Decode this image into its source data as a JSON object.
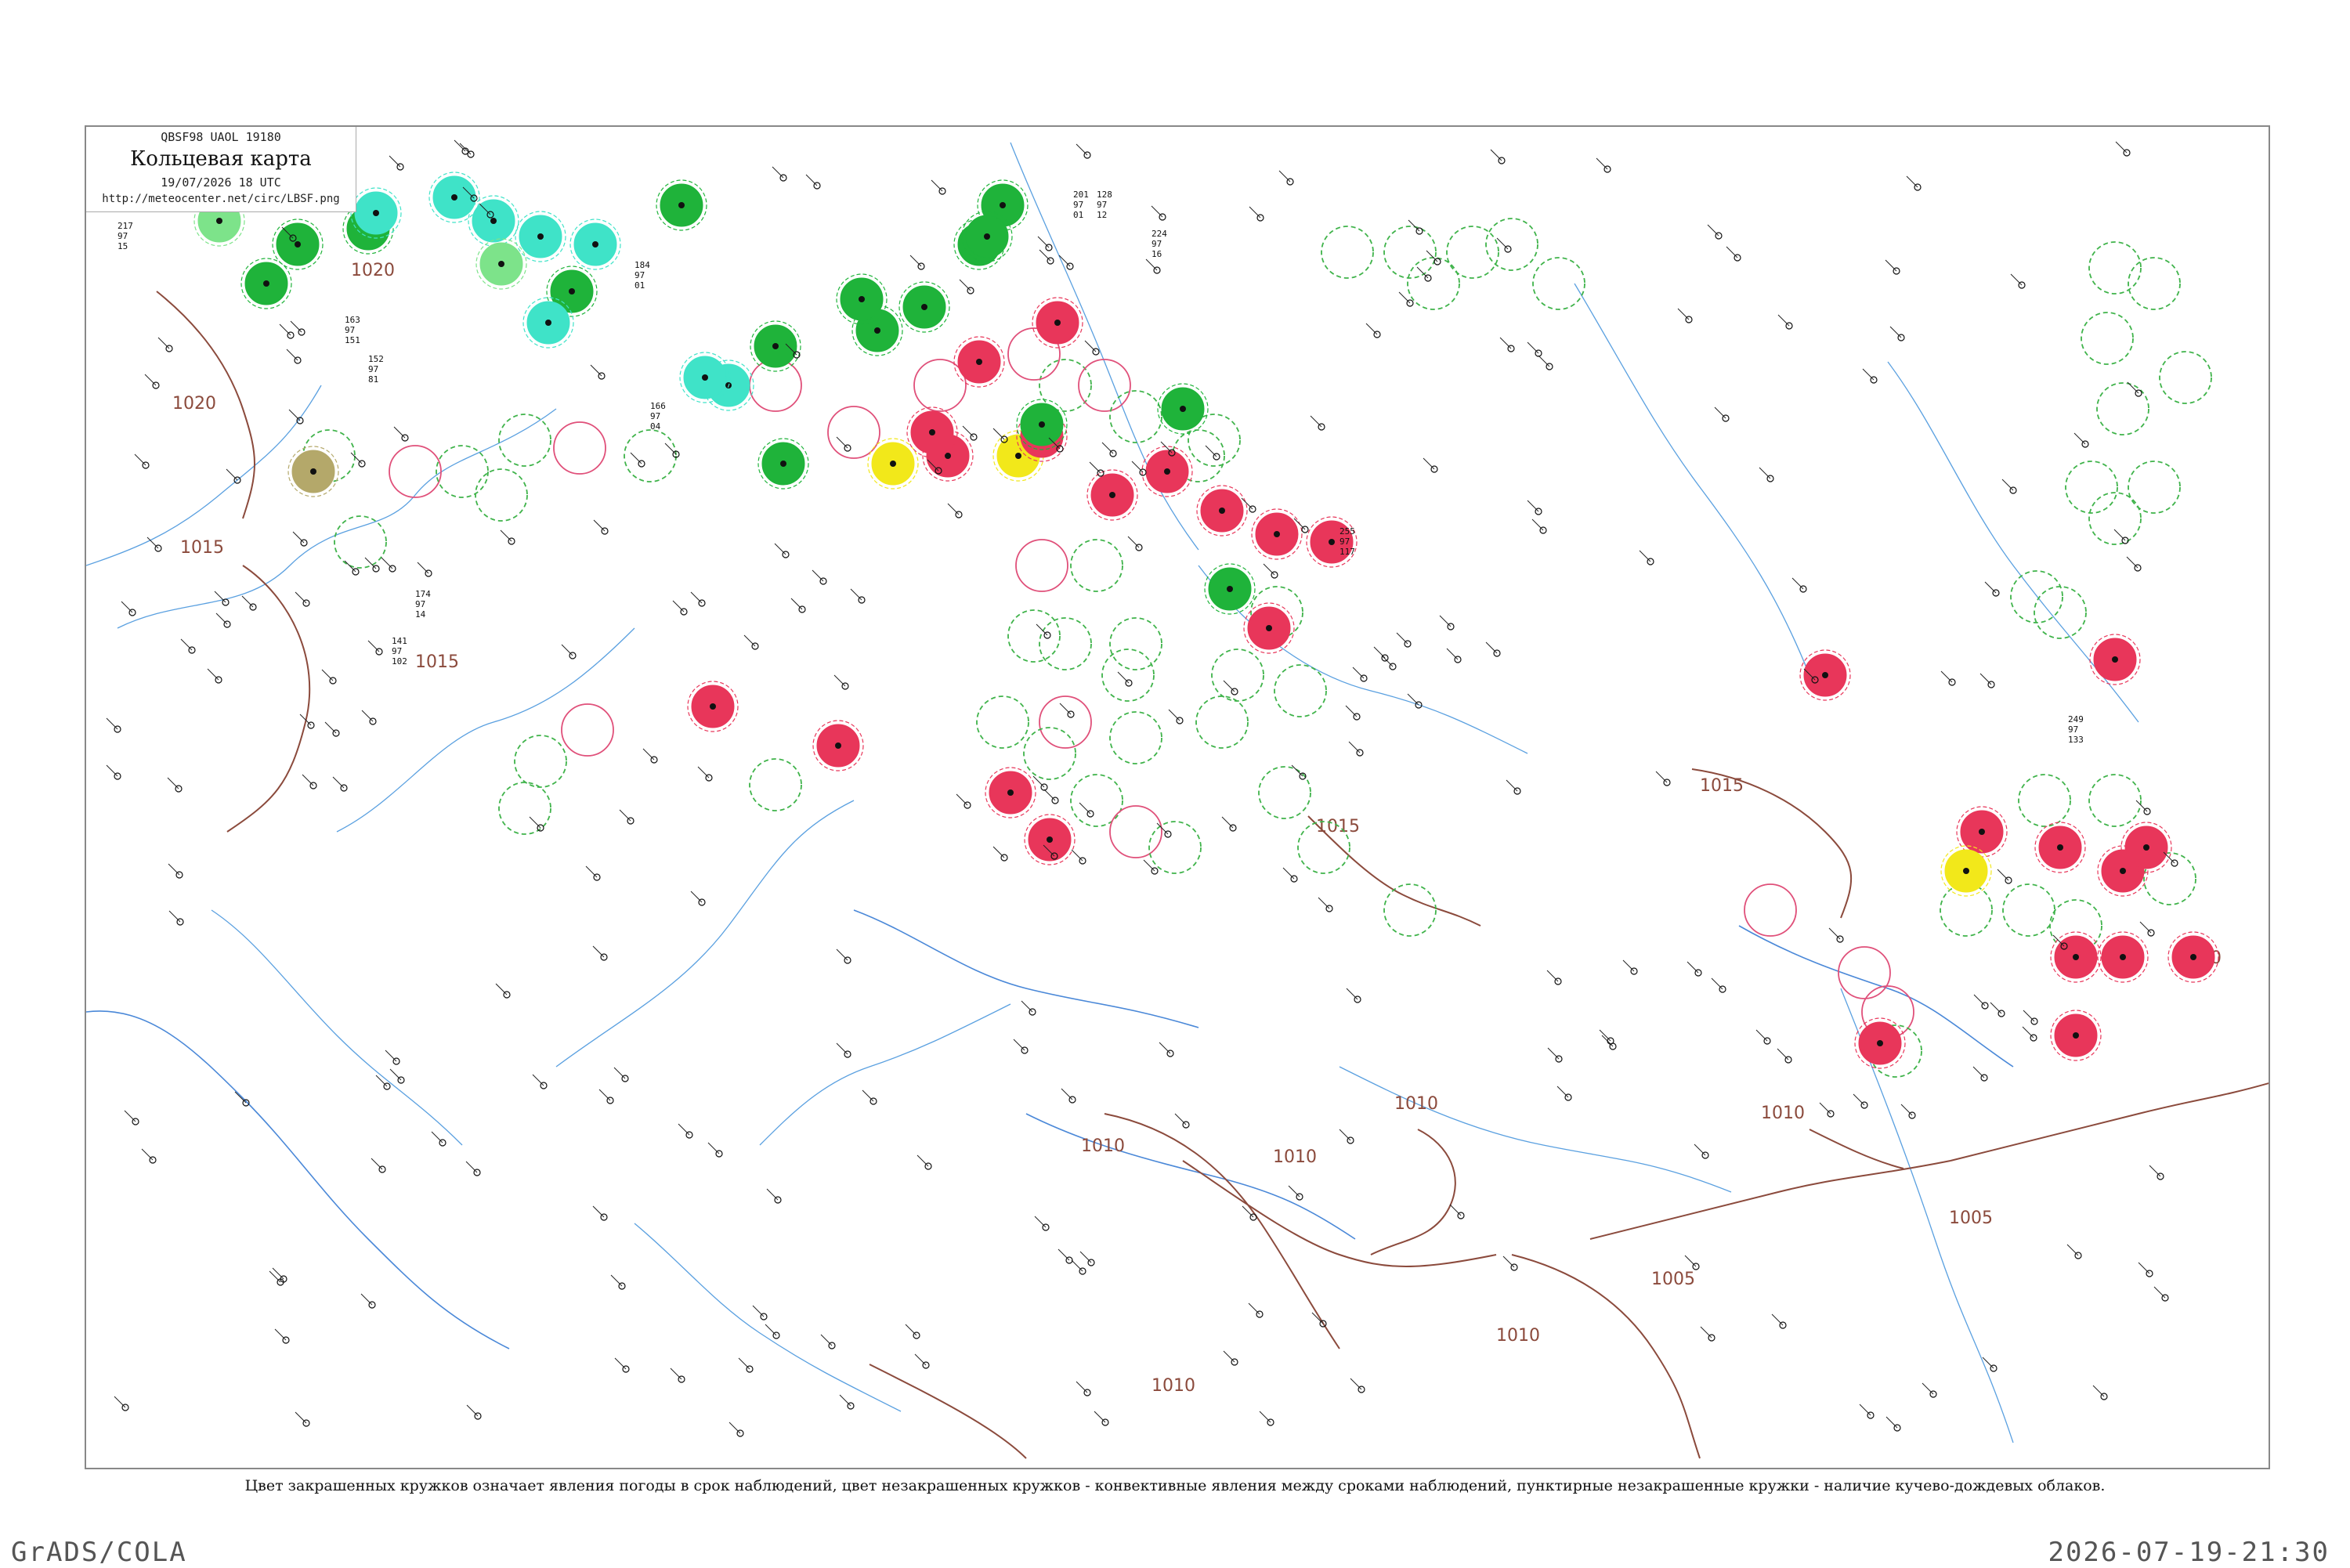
{
  "header": {
    "code_line": "QBSF98  UAOL  19180",
    "title": "Кольцевая карта",
    "date_line": "19/07/2026 18 UTC",
    "url": "http://meteocenter.net/circ/LBSF.png"
  },
  "caption": "Цвет закрашенных кружков означает явления погоды в срок наблюдений, цвет незакрашенных кружков - конвективные явления между сроками наблюдений, пунктирные незакрашенные кружки - наличие кучево-дождевых облаков.",
  "footer": {
    "left": "GrADS/COLA",
    "right": "2026-07-19-21:30"
  },
  "colors": {
    "rain_red": "#e8365a",
    "shower_green": "#1fb33a",
    "drizzle_aqua": "#3fe3c8",
    "light_green": "#7de38a",
    "fog_yellow": "#f2e81a",
    "haze_olive": "#b4a86a",
    "isobar_brown": "#8b4a3c",
    "river_blue": "#5aa0e0",
    "cb_dashed_green": "#3fb34a",
    "convective_pink": "#e0507a"
  },
  "isobars": {
    "labels": [
      "1020",
      "1020",
      "1015",
      "1015",
      "1015",
      "1015",
      "1010",
      "1010",
      "1010",
      "1010",
      "1010",
      "1005",
      "1005",
      "1010",
      "1010"
    ]
  },
  "stations": [
    {
      "name": "st-1",
      "temp": "217",
      "dew": "97",
      "code": "15"
    },
    {
      "name": "st-2",
      "temp": "163",
      "dew": "97",
      "code": "151"
    },
    {
      "name": "st-3",
      "temp": "152",
      "dew": "97",
      "code": "81"
    },
    {
      "name": "st-4",
      "temp": "184",
      "dew": "97",
      "code": "01"
    },
    {
      "name": "st-5",
      "temp": "166",
      "dew": "97",
      "code": "04"
    },
    {
      "name": "st-6",
      "temp": "141",
      "dew": "97",
      "code": "102"
    },
    {
      "name": "st-7",
      "temp": "174",
      "dew": "97",
      "code": "14"
    },
    {
      "name": "st-8",
      "temp": "224",
      "dew": "97",
      "code": "16"
    },
    {
      "name": "st-9",
      "temp": "255",
      "dew": "97",
      "code": "117"
    },
    {
      "name": "st-10",
      "temp": "249",
      "dew": "97",
      "code": "133"
    },
    {
      "name": "st-11",
      "temp": "201",
      "dew": "97",
      "code": "01"
    },
    {
      "name": "st-12",
      "temp": "128",
      "dew": "97",
      "code": "12"
    }
  ]
}
